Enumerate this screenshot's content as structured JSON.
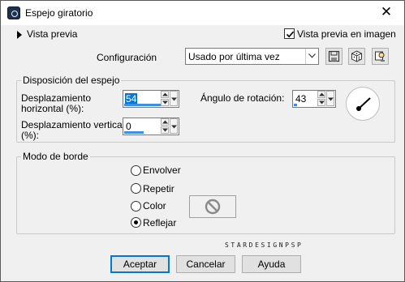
{
  "window": {
    "title": "Espejo giratorio",
    "close_glyph": "✕"
  },
  "preview": {
    "toggle_label": "Vista previa",
    "checkbox_label": "Vista previa en imagen",
    "checked": true
  },
  "config": {
    "label": "Configuración",
    "selected": "Usado por última vez",
    "icons": [
      "save-icon",
      "random-dice-icon",
      "reset-icon"
    ]
  },
  "mirror_group": {
    "legend": "Disposición del espejo",
    "horizontal_label_1": "Desplazamiento",
    "horizontal_label_2": "horizontal (%):",
    "horizontal_value": "54",
    "vertical_label_1": "Desplazamiento vertical",
    "vertical_label_2": "(%):",
    "vertical_value": "0",
    "rotation_label": "Ángulo de rotación:",
    "rotation_value": "43"
  },
  "border_group": {
    "legend": "Modo de borde",
    "options": [
      "Envolver",
      "Repetir",
      "Color",
      "Reflejar"
    ],
    "selected": "Reflejar"
  },
  "credit_text": "STARDESIGNPSP",
  "buttons": {
    "ok": "Aceptar",
    "cancel": "Cancelar",
    "help": "Ayuda"
  },
  "colors": {
    "accent": "#0078d7",
    "slider_fill": "#3c8ee0",
    "title_bg": "#ffffff",
    "dialog_bg": "#f0f0f0"
  }
}
